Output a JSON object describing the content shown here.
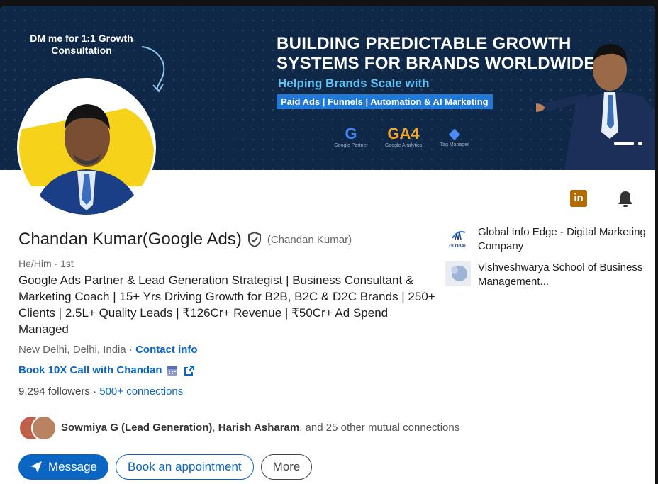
{
  "banner": {
    "dm_text": "DM me for 1:1 Growth Consultation",
    "headline_line1": "BUILDING PREDICTABLE GROWTH",
    "headline_line2": "SYSTEMS FOR BRANDS WORLDWIDE",
    "subheadline": "Helping Brands Scale with",
    "pill": "Paid Ads | Funnels | Automation & AI Marketing",
    "partners": [
      {
        "glyph": "G",
        "caption": "Google Partner"
      },
      {
        "glyph": "GA4",
        "caption": "Google Analytics"
      },
      {
        "glyph": "◆",
        "caption": "Tag Manager"
      }
    ]
  },
  "profile": {
    "name": "Chandan Kumar(Google Ads)",
    "pronunciation": "(Chandan Kumar)",
    "meta": "He/Him · 1st",
    "headline": "Google Ads Partner & Lead Generation Strategist | Business Consultant & Marketing Coach | 15+ Yrs Driving Growth for B2B, B2C & D2C Brands | 250+ Clients | 2.5L+ Quality Leads | ₹126Cr+ Revenue | ₹50Cr+ Ad Spend Managed",
    "location": "New Delhi, Delhi, India · ",
    "contact_info": "Contact info",
    "book_call": "Book 10X Call with Chandan",
    "followers": "9,294 followers",
    "connections": "500+ connections"
  },
  "companies": [
    {
      "name": "Global Info Edge - Digital Marketing Company",
      "logo_text": "GLOBAL"
    },
    {
      "name": "Vishveshwarya School of Business Management..."
    }
  ],
  "mutual": {
    "name1": "Sowmiya G (Lead Generation)",
    "sep": ", ",
    "name2": "Harish Asharam",
    "rest": ", and 25 other mutual connections"
  },
  "actions": {
    "message": "Message",
    "book_appointment": "Book an appointment",
    "more": "More"
  },
  "icons": {
    "linkedin_icon": "in"
  },
  "colors": {
    "accent": "#0a66c2",
    "banner_bg": "#0f2847",
    "banner_sub": "#5ec2f5",
    "pill_bg": "#2079d8"
  }
}
